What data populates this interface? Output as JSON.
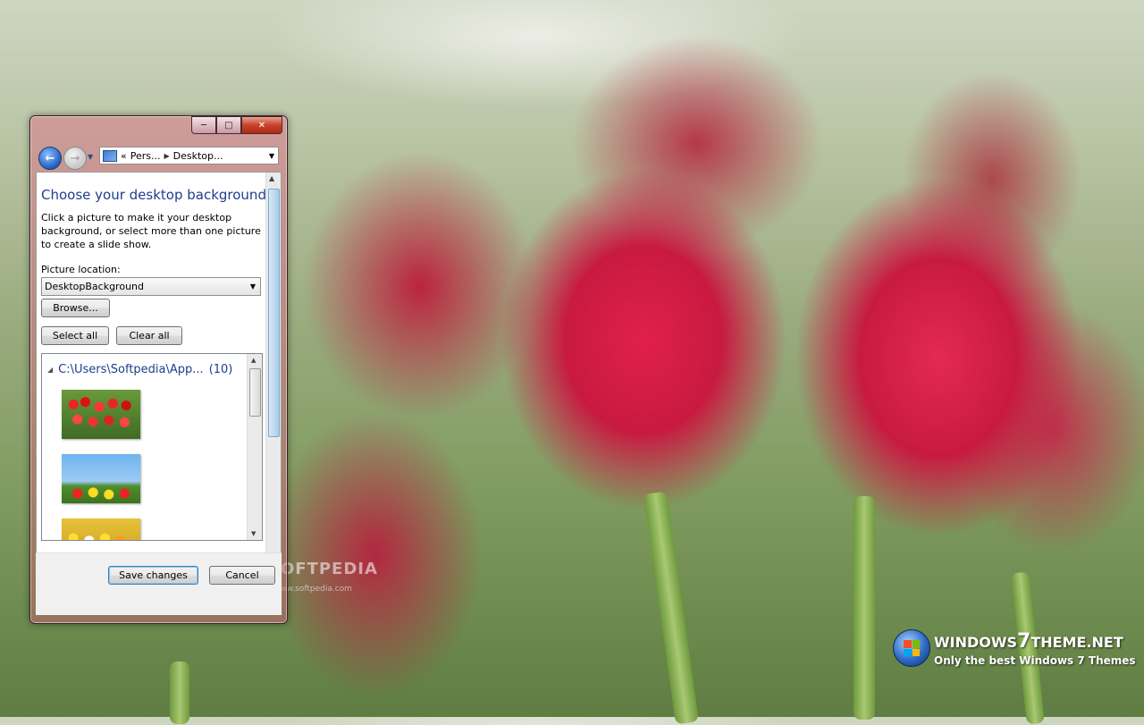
{
  "window": {
    "breadcrumb": {
      "overflow": "«",
      "items": [
        "Pers...",
        "Desktop..."
      ]
    },
    "heading": "Choose your desktop background",
    "description": "Click a picture to make it your desktop background, or select more than one picture to create a slide show.",
    "picture_location": {
      "label": "Picture location:",
      "value": "DesktopBackground"
    },
    "browse_label": "Browse...",
    "select_all_label": "Select all",
    "clear_all_label": "Clear all",
    "group": {
      "path": "C:\\Users\\Softpedia\\App...",
      "count": "(10)"
    },
    "thumbnails": [
      "red-tulips",
      "windmill-tulips",
      "yellow-flowers"
    ],
    "save_label": "Save changes",
    "cancel_label": "Cancel"
  },
  "watermark": {
    "text": "SOFTPEDIA",
    "url": "www.softpedia.com"
  },
  "brand": {
    "name_prefix": "WINDOWS",
    "name_seven": "7",
    "name_suffix": "THEME.NET",
    "tagline": "Only the best Windows 7 Themes"
  },
  "colors": {
    "heading": "#1e3d8f",
    "accent_red": "#c81a40"
  },
  "icons": [
    "back-arrow-icon",
    "forward-arrow-icon",
    "control-panel-icon",
    "chevron-down-icon",
    "windows-orb-icon"
  ]
}
